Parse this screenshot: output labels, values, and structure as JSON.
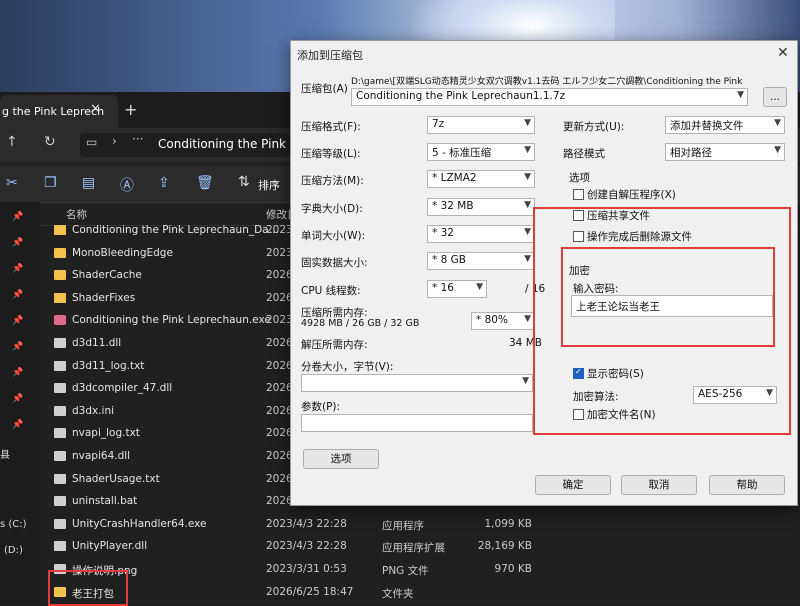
{
  "explorer": {
    "tab_title": "g the Pink Leprech",
    "tab_close": "✕",
    "tab_new": "+",
    "breadcrumb": "Conditioning the Pink Lepr",
    "sort_label": "排序",
    "col_name": "名称",
    "col_date": "修改日",
    "side_labels": [
      "s (C:)",
      "(D:)",
      "县"
    ],
    "files": [
      {
        "name": "Conditioning the Pink Leprechaun_Da…",
        "date": "2023/",
        "type": "",
        "size": "",
        "kind": "folder"
      },
      {
        "name": "MonoBleedingEdge",
        "date": "2023/",
        "type": "",
        "size": "",
        "kind": "folder"
      },
      {
        "name": "ShaderCache",
        "date": "2026/",
        "type": "",
        "size": "",
        "kind": "folder"
      },
      {
        "name": "ShaderFixes",
        "date": "2026/",
        "type": "",
        "size": "",
        "kind": "folder"
      },
      {
        "name": "Conditioning the Pink Leprechaun.exe",
        "date": "2023/",
        "type": "",
        "size": "",
        "kind": "exe"
      },
      {
        "name": "d3d11.dll",
        "date": "2026/",
        "type": "",
        "size": "",
        "kind": "file"
      },
      {
        "name": "d3d11_log.txt",
        "date": "2026/",
        "type": "",
        "size": "",
        "kind": "file"
      },
      {
        "name": "d3dcompiler_47.dll",
        "date": "2026/",
        "type": "",
        "size": "",
        "kind": "file"
      },
      {
        "name": "d3dx.ini",
        "date": "2026/",
        "type": "",
        "size": "",
        "kind": "file"
      },
      {
        "name": "nvapi_log.txt",
        "date": "2026/",
        "type": "",
        "size": "",
        "kind": "file"
      },
      {
        "name": "nvapi64.dll",
        "date": "2026/",
        "type": "",
        "size": "",
        "kind": "file"
      },
      {
        "name": "ShaderUsage.txt",
        "date": "2026/",
        "type": "",
        "size": "",
        "kind": "file"
      },
      {
        "name": "uninstall.bat",
        "date": "2026/",
        "type": "",
        "size": "",
        "kind": "file"
      },
      {
        "name": "UnityCrashHandler64.exe",
        "date": "2023/4/3 22:28",
        "type": "应用程序",
        "size": "1,099 KB",
        "kind": "file"
      },
      {
        "name": "UnityPlayer.dll",
        "date": "2023/4/3 22:28",
        "type": "应用程序扩展",
        "size": "28,169 KB",
        "kind": "file"
      },
      {
        "name": "操作说明.png",
        "date": "2023/3/31 0:53",
        "type": "PNG 文件",
        "size": "970 KB",
        "kind": "file"
      },
      {
        "name": "老王打包",
        "date": "2026/6/25 18:47",
        "type": "文件夹",
        "size": "",
        "kind": "folder"
      }
    ]
  },
  "dialog": {
    "title": "添加到压缩包",
    "close": "✕",
    "archive_label": "压缩包(A)",
    "archive_path": "D:\\game\\[双端SLG动态精灵少女双穴调教v1.1去码 エルフ少女二穴調教\\Conditioning the Pink",
    "archive_name": "Conditioning the Pink Leprechaun1.1.7z",
    "browse": "...",
    "format_label": "压缩格式(F):",
    "format": "7z",
    "level_label": "压缩等级(L):",
    "level": "5 - 标准压缩",
    "method_label": "压缩方法(M):",
    "method": "* LZMA2",
    "dict_label": "字典大小(D):",
    "dict": "* 32 MB",
    "word_label": "单词大小(W):",
    "word": "* 32",
    "solid_label": "固实数据大小:",
    "solid": "* 8 GB",
    "threads_label": "CPU 线程数:",
    "threads": "* 16",
    "threads_total": "/ 16",
    "mem_label": "压缩所需内存:",
    "mem_value": "4928 MB / 26 GB / 32 GB",
    "mem_pct": "* 80%",
    "demem_label": "解压所需内存:",
    "demem_value": "34 MB",
    "split_label": "分卷大小，字节(V):",
    "params_label": "参数(P):",
    "options_btn": "选项",
    "update_label": "更新方式(U):",
    "update": "添加并替换文件",
    "pathmode_label": "路径模式",
    "pathmode": "相对路径",
    "options_group": "选项",
    "opt_sfx": "创建自解压程序(X)",
    "opt_shared": "压缩共享文件",
    "opt_delete": "操作完成后删除源文件",
    "encrypt_group": "加密",
    "password_label": "输入密码:",
    "password": "上老王论坛当老王",
    "show_password": "显示密码(S)",
    "algo_label": "加密算法:",
    "algo": "AES-256",
    "encrypt_names": "加密文件名(N)",
    "ok": "确定",
    "cancel": "取消",
    "help": "帮助"
  },
  "colors": {
    "highlight": "#e23b3b",
    "folder": "#f2c14e",
    "accent": "#1f5fbf"
  }
}
